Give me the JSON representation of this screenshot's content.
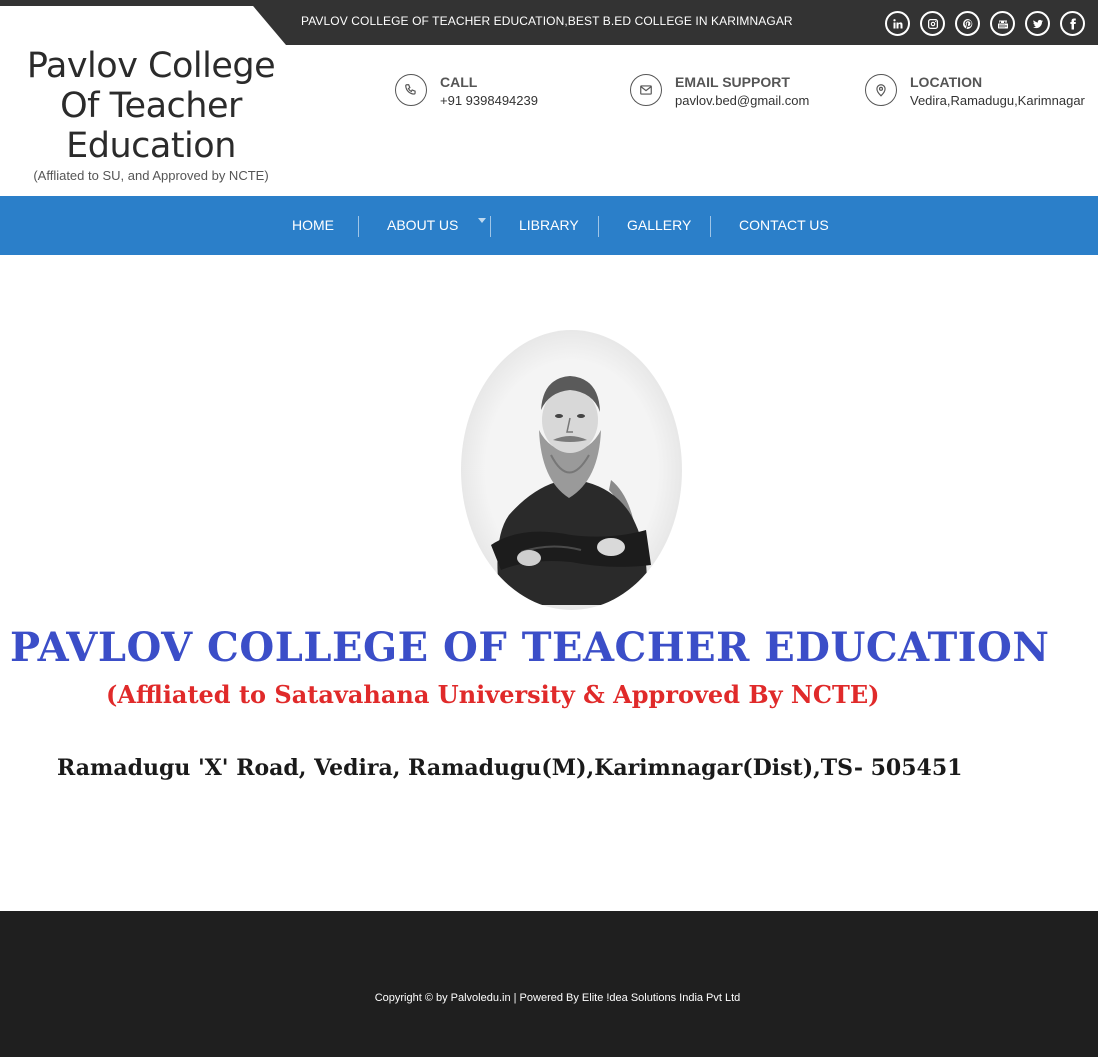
{
  "topbar": {
    "tagline": "PAVLOV COLLEGE OF TEACHER EDUCATION,BEST B.ED COLLEGE IN KARIMNAGAR",
    "socials": [
      "linkedin-icon",
      "instagram-icon",
      "pinterest-icon",
      "youtube-icon",
      "twitter-icon",
      "facebook-icon"
    ]
  },
  "brand": {
    "title_line1": "Pavlov College",
    "title_line2": "Of Teacher",
    "title_line3": "Education",
    "subtitle": "(Affliated to SU, and Approved by NCTE)"
  },
  "contacts": {
    "call": {
      "label": "CALL",
      "value": "+91 9398494239",
      "icon": "phone-icon"
    },
    "email": {
      "label": "EMAIL SUPPORT",
      "value": "pavlov.bed@gmail.com",
      "icon": "envelope-icon"
    },
    "location": {
      "label": "LOCATION",
      "value": "Vedira,Ramadugu,Karimnagar",
      "icon": "map-pin-icon"
    }
  },
  "nav": {
    "home": "HOME",
    "about": "ABOUT US",
    "library": "LIBRARY",
    "gallery": "GALLERY",
    "contact": "CONTACT US"
  },
  "hero": {
    "title": "PAVLOV COLLEGE OF TEACHER EDUCATION",
    "subtitle": "(Affliated to Satavahana University & Approved By NCTE)",
    "address": "Ramadugu 'X' Road, Vedira, Ramadugu(M),Karimnagar(Dist),TS- 505451"
  },
  "footer": {
    "copyright": "Copyright © by Palvoledu.in | Powered By Elite !dea Solutions India Pvt Ltd"
  },
  "colors": {
    "nav_bg": "#2b7fc9",
    "topbar_bg": "#333333",
    "footer_bg": "#1f1f1f",
    "hero_title": "#3b4ec8",
    "hero_subtitle": "#e02a2a"
  }
}
